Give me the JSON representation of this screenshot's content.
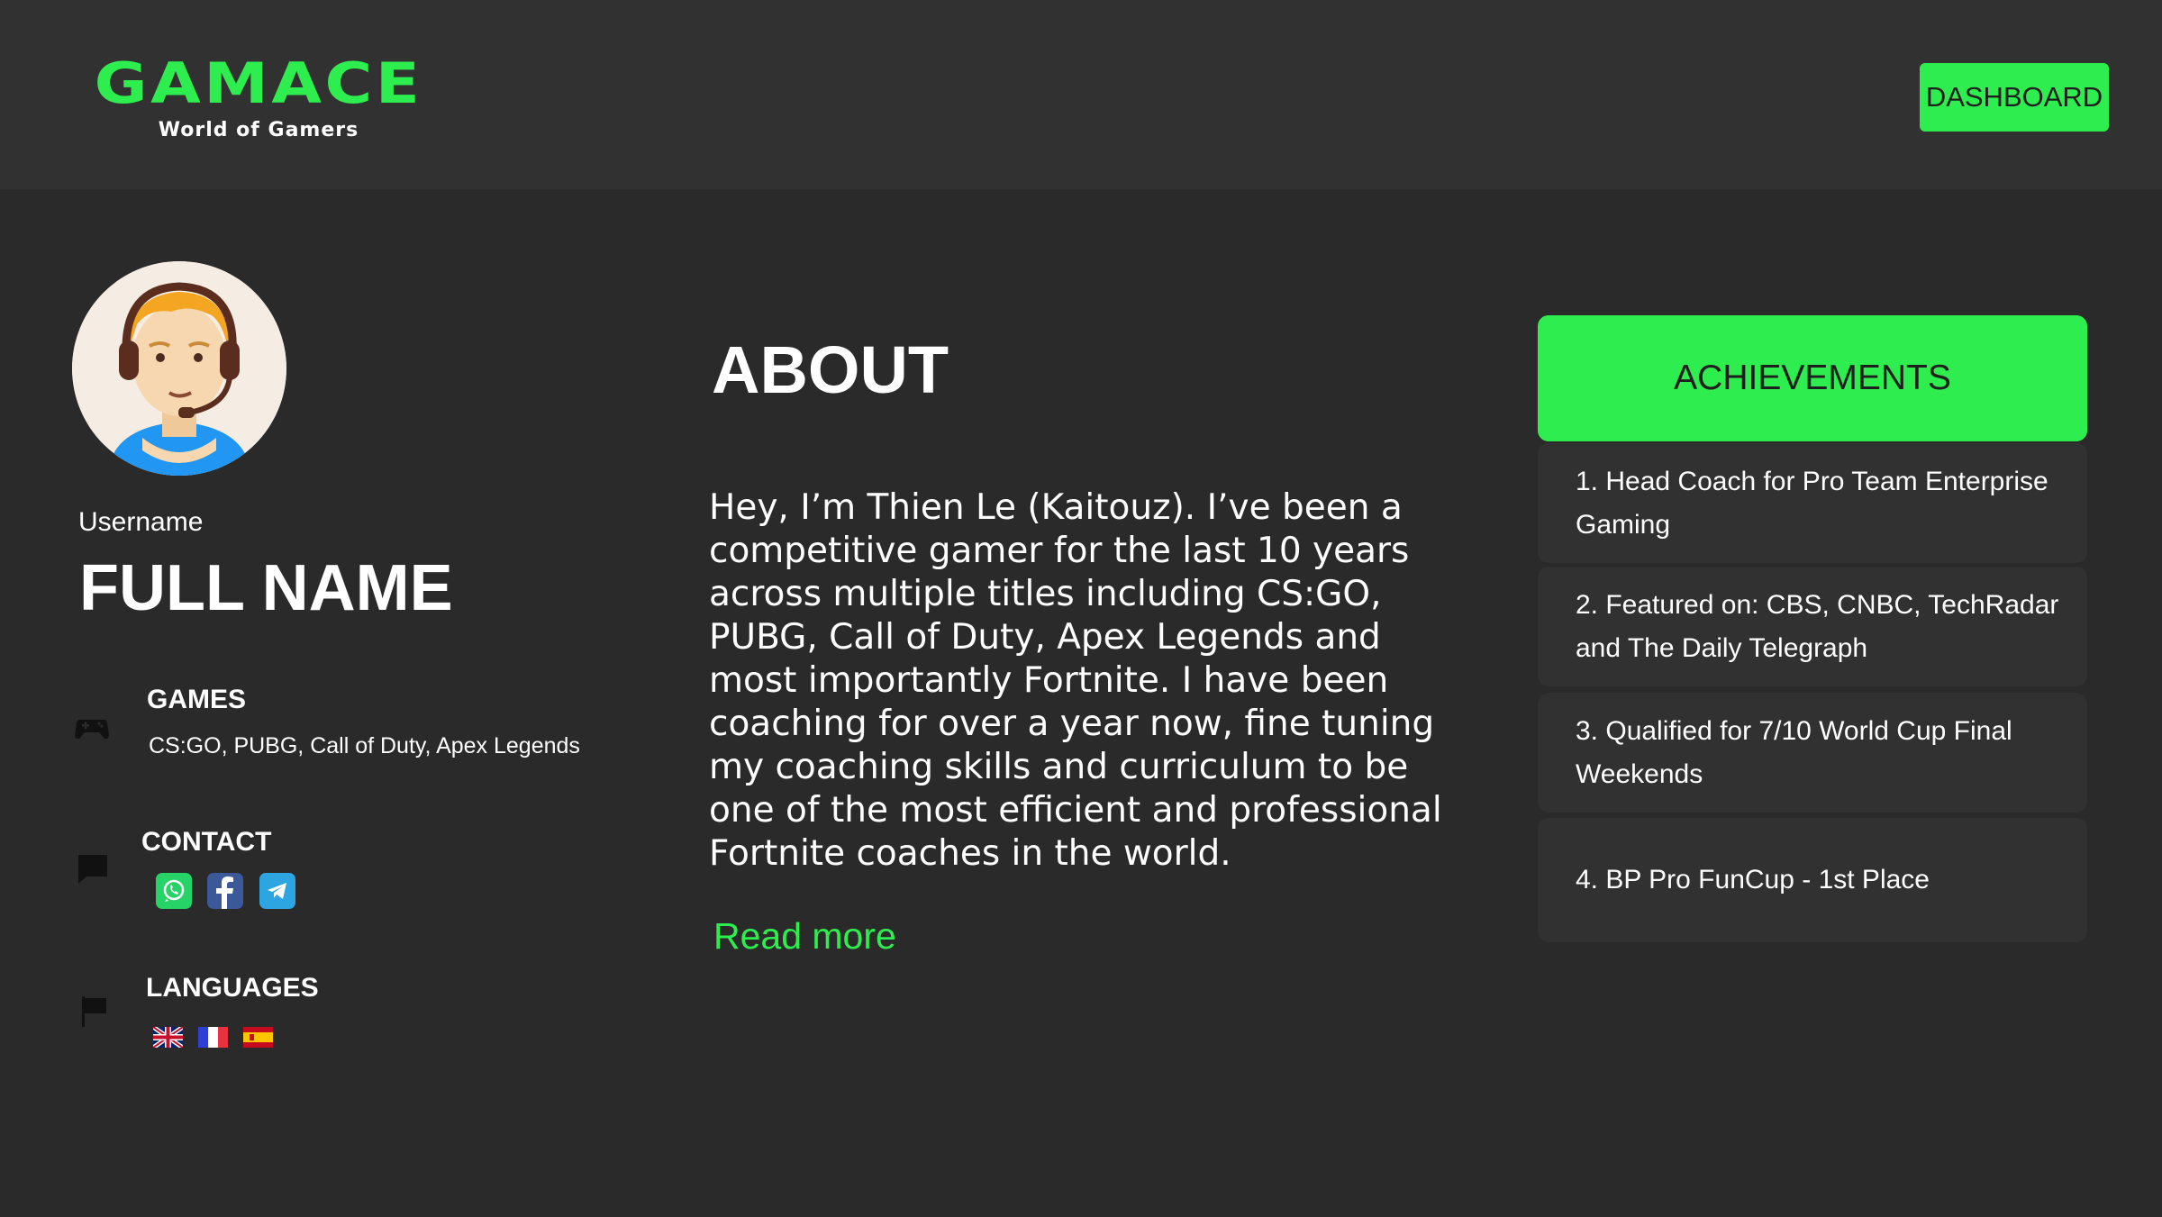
{
  "header": {
    "logo_title": "GAMACE",
    "logo_subtitle": "World of Gamers",
    "dashboard_label": "DASHBOARD"
  },
  "colors": {
    "accent": "#2ded4f",
    "background": "#2a2a2a",
    "panel": "#313131"
  },
  "profile": {
    "avatar_icon": "gamer-headset-avatar",
    "username_label": "Username",
    "full_name": "FULL NAME"
  },
  "games": {
    "icon": "gamepad-icon",
    "title": "GAMES",
    "list": "CS:GO, PUBG, Call of Duty, Apex Legends"
  },
  "contact": {
    "icon": "chat-icon",
    "title": "CONTACT",
    "channels": [
      "whatsapp-icon",
      "facebook-icon",
      "telegram-icon"
    ]
  },
  "languages": {
    "icon": "flag-icon",
    "title": "LANGUAGES",
    "flags": [
      "uk-flag",
      "france-flag",
      "spain-flag"
    ]
  },
  "about": {
    "title": "ABOUT",
    "text": "Hey, I’m Thien Le (Kaitouz). I’ve been a competitive gamer for the last 10 years across multiple titles including CS:GO, PUBG, Call of Duty, Apex Legends and most importantly Fortnite. I have been coaching for over a year now, fine tuning my coaching skills and curriculum to be one of the most efficient and professional Fortnite coaches in the world.",
    "read_more": "Read more"
  },
  "achievements": {
    "title": "ACHIEVEMENTS",
    "items": [
      "1. Head Coach for Pro Team Enterprise Gaming",
      "2. Featured on: CBS, CNBC, TechRadar and The Daily Telegraph",
      "3. Qualified for 7/10 World Cup Final Weekends",
      "4. BP Pro FunCup - 1st Place"
    ]
  }
}
